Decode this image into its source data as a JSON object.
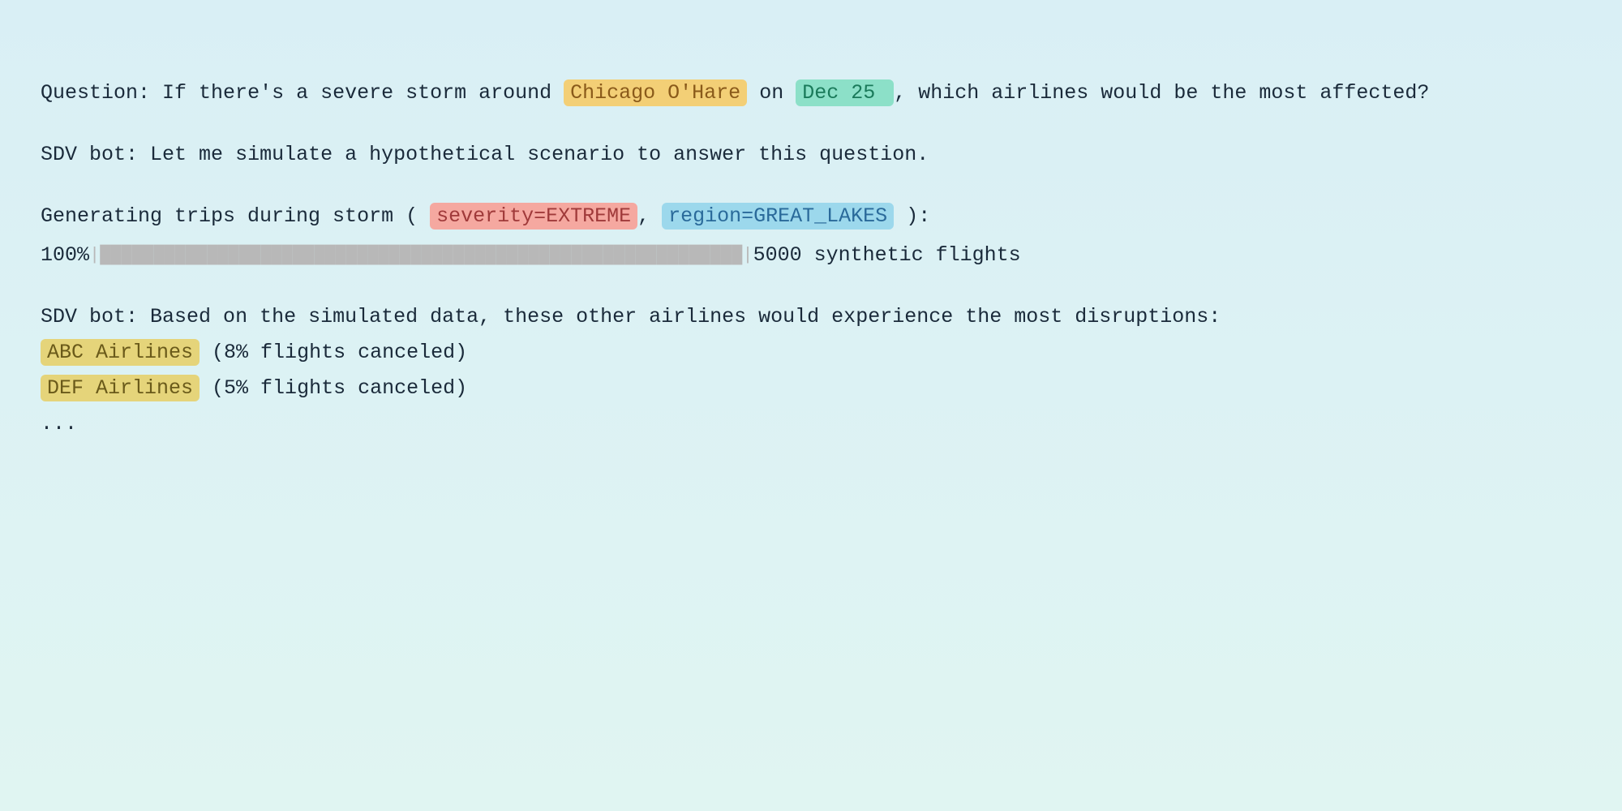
{
  "question_label": "Question:",
  "question_part1": "If there's a severe storm around",
  "question_airport": "Chicago O'Hare",
  "question_on": "on",
  "question_date": "Dec 25 ",
  "question_part2": ", which airlines would be the most affected?",
  "bot_label": "SDV bot:",
  "bot_intro": "Let me simulate a hypothetical scenario to answer this question.",
  "gen_prefix": "Generating trips during storm ( ",
  "gen_severity": "severity=EXTREME",
  "gen_sep": ", ",
  "gen_region": "region=GREAT_LAKES",
  "gen_suffix": "):",
  "progress_percent": "100%",
  "progress_bar": "|████████████████████████████████████████████████████████████|",
  "progress_count": " 5000 synthetic flights",
  "bot_result_intro": "Based on the simulated data, these other airlines would experience the most disruptions:",
  "results": [
    {
      "name": "ABC Airlines",
      "stat": "(8% flights canceled)"
    },
    {
      "name": "DEF Airlines",
      "stat": "(5% flights canceled)"
    }
  ],
  "ellipsis": "..."
}
